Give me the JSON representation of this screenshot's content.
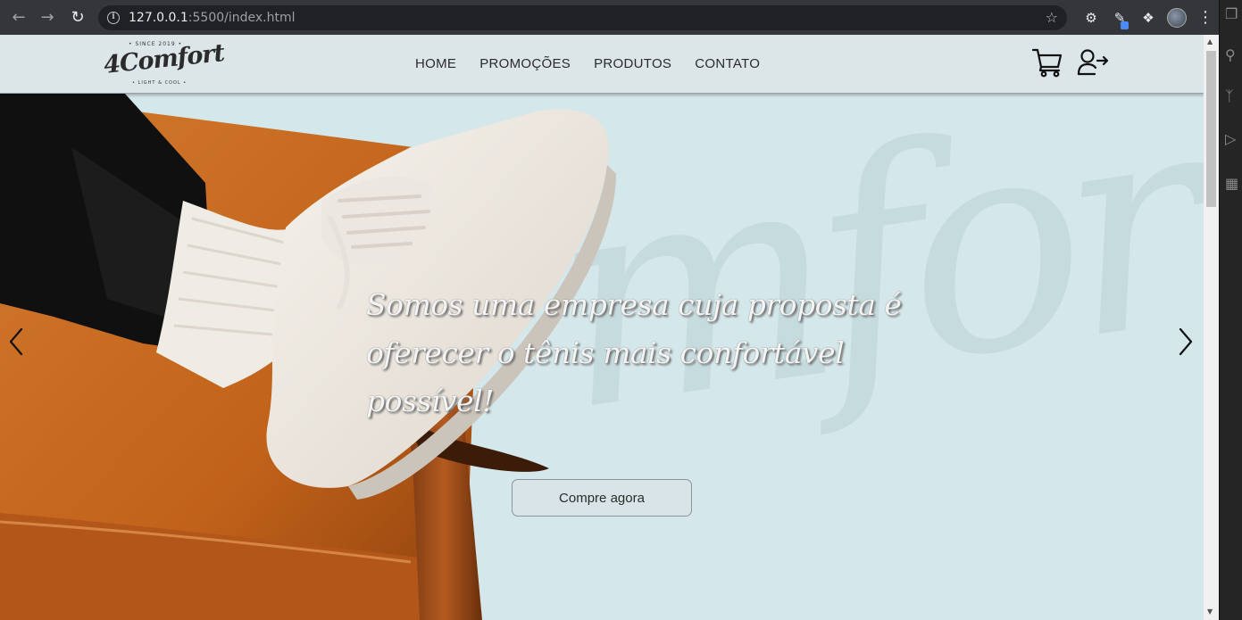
{
  "browser": {
    "url_host": "127.0.0.1",
    "url_path": ":5500/index.html"
  },
  "site": {
    "logo": {
      "since": "• SINCE 2019 •",
      "brand": "4Comfort",
      "tagline": "• LIGHT & COOL •"
    },
    "nav": [
      {
        "label": "HOME"
      },
      {
        "label": "PROMOÇÕES"
      },
      {
        "label": "PRODUTOS"
      },
      {
        "label": "CONTATO"
      }
    ],
    "icons": {
      "cart": "cart-icon",
      "login": "login-icon"
    }
  },
  "hero": {
    "watermark": "mfort",
    "headline": "Somos uma empresa cuja proposta é oferecer o tênis mais confortável possível!",
    "cta_label": "Compre agora"
  },
  "colors": {
    "header_bg": "#dce6e9",
    "hero_bg": "#d4e7ea",
    "chair": "#c7661c",
    "browser_chrome": "#35363a"
  }
}
